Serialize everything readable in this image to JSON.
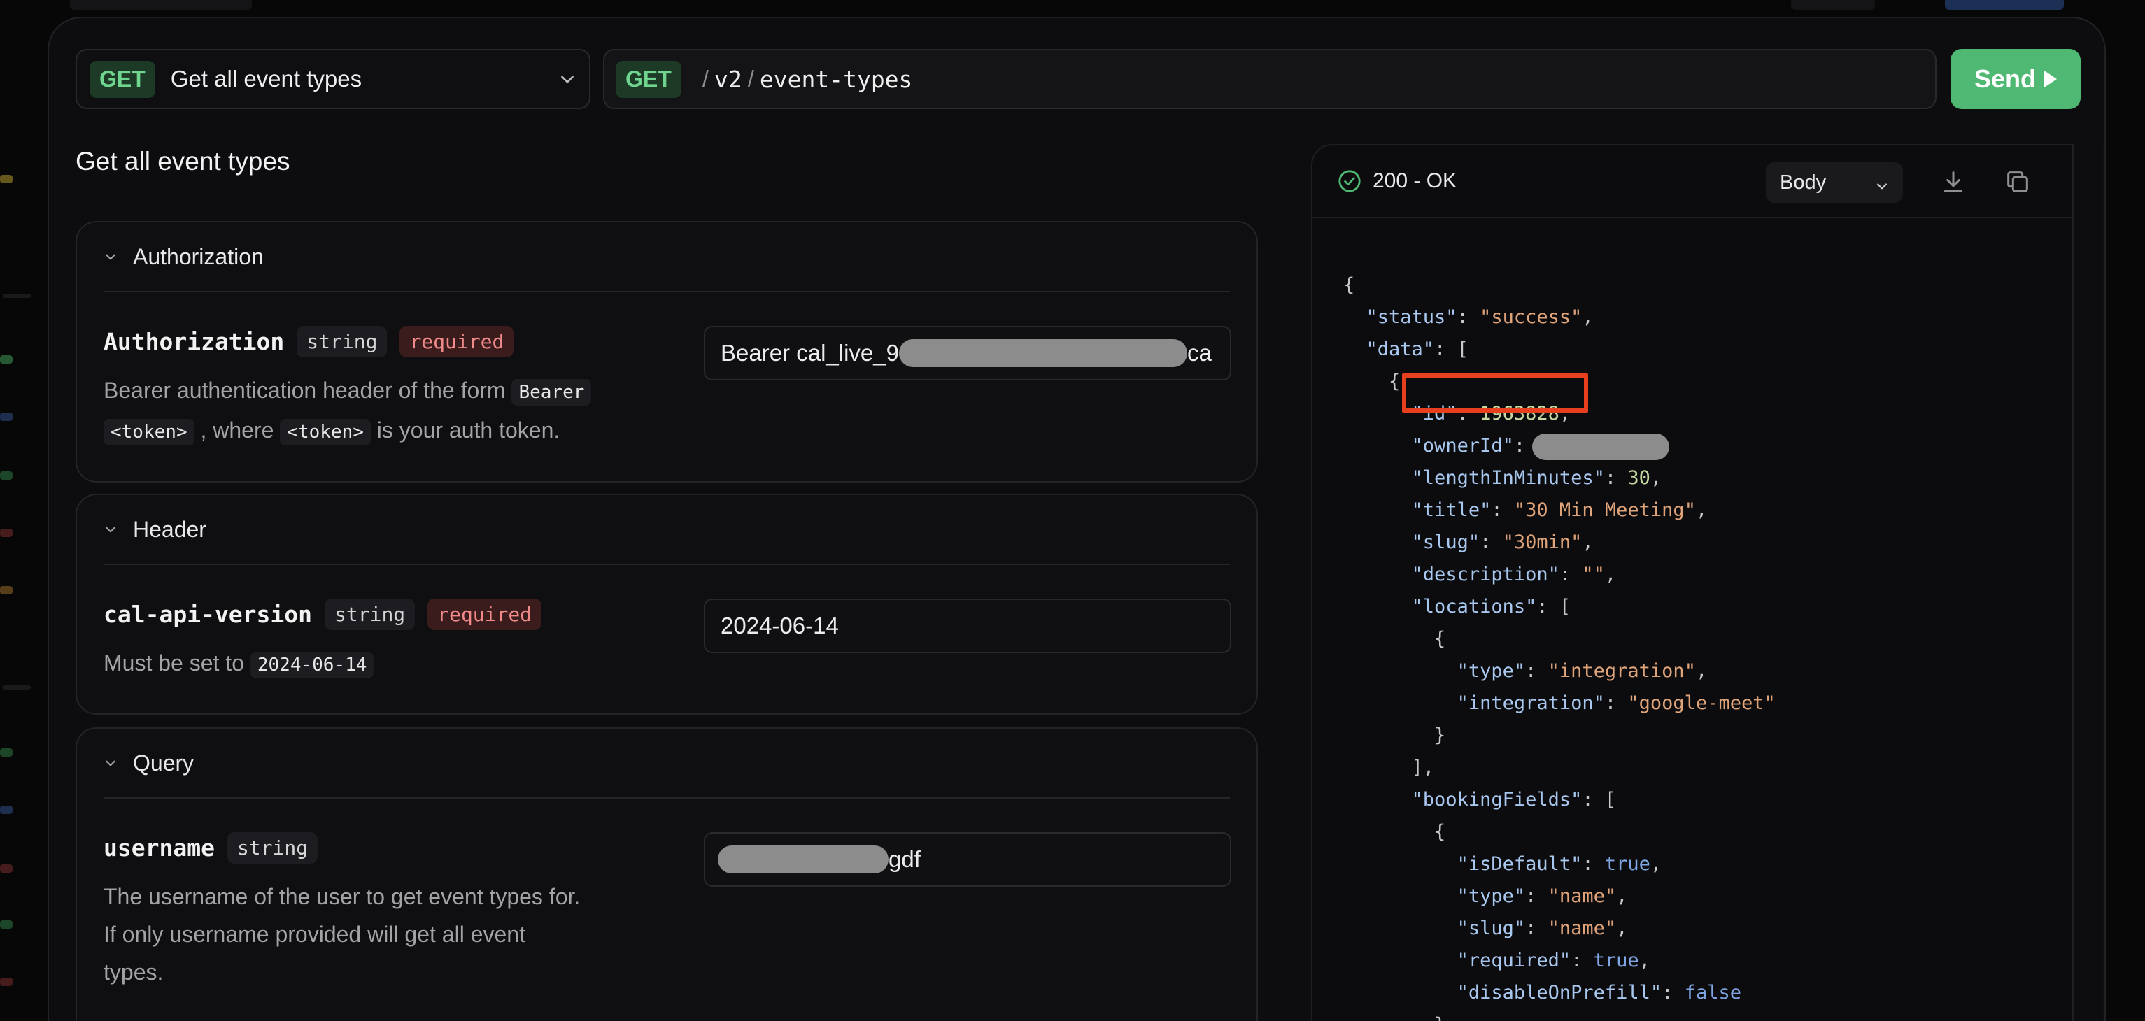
{
  "request": {
    "method": "GET",
    "endpoint_title": "Get all event types",
    "url_segments": [
      "v2",
      "event-types"
    ],
    "send_label": "Send"
  },
  "page_title": "Get all event types",
  "sections": {
    "authorization": {
      "title": "Authorization",
      "param_name": "Authorization",
      "type": "string",
      "required": "required",
      "desc_1": "Bearer authentication header of the form",
      "chip_bearer": "Bearer",
      "chip_token": "<token>",
      "desc_2": ", where",
      "chip_token2": "<token>",
      "desc_3": "is your auth token.",
      "value_prefix": "Bearer cal_live_9",
      "value_suffix": "ca"
    },
    "header": {
      "title": "Header",
      "param_name": "cal-api-version",
      "type": "string",
      "required": "required",
      "desc": "Must be set to",
      "chip": "2024-06-14",
      "value": "2024-06-14"
    },
    "query": {
      "title": "Query",
      "param_name": "username",
      "type": "string",
      "desc_line1": "The username of the user to get event types for.",
      "desc_line2": "If only username provided will get all event",
      "desc_line3": "types.",
      "value_suffix": "gdf"
    }
  },
  "response": {
    "status": "200 - OK",
    "view": "Body",
    "lines": [
      "{",
      "  \"status\": \"success\",",
      "  \"data\": [",
      "    {",
      "      \"id\": 1963828,",
      "      \"ownerId\":",
      "      \"lengthInMinutes\": 30,",
      "      \"title\": \"30 Min Meeting\",",
      "      \"slug\": \"30min\",",
      "      \"description\": \"\",",
      "      \"locations\": [",
      "        {",
      "          \"type\": \"integration\",",
      "          \"integration\": \"google-meet\"",
      "        }",
      "      ],",
      "      \"bookingFields\": [",
      "        {",
      "          \"isDefault\": true,",
      "          \"type\": \"name\",",
      "          \"slug\": \"name\",",
      "          \"required\": true,",
      "          \"disableOnPrefill\": false",
      "        },"
    ]
  },
  "colors": {
    "accent_green": "#4fb873",
    "highlight_red": "#e8401f",
    "required_red": "#f08a8a"
  },
  "icons": [
    "chevron-down-icon",
    "play-icon",
    "check-circle-icon",
    "download-icon",
    "copy-icon"
  ]
}
